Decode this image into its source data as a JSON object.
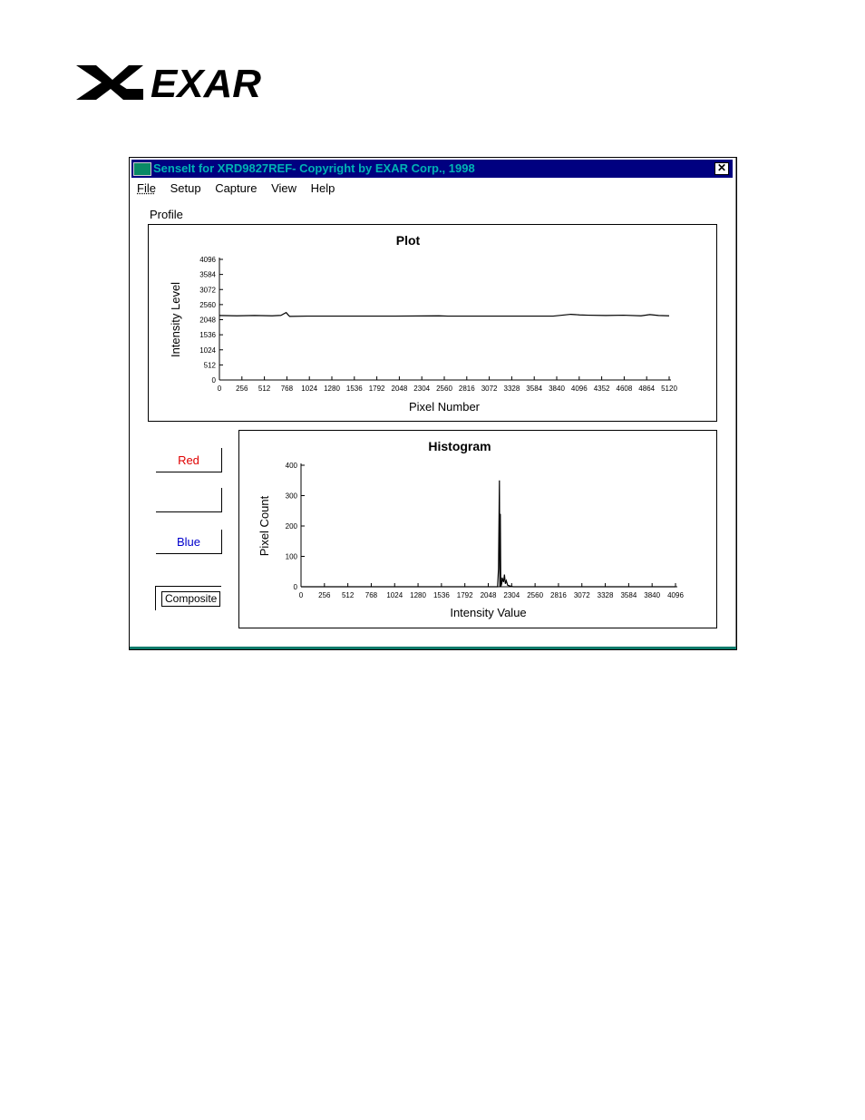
{
  "logo": {
    "text": "EXAR"
  },
  "window": {
    "title": "SenseIt for XRD9827REF- Copyright by EXAR Corp., 1998",
    "close_glyph": "✕"
  },
  "menu": [
    {
      "label": "File"
    },
    {
      "label": "Setup"
    },
    {
      "label": "Capture"
    },
    {
      "label": "View"
    },
    {
      "label": "Help"
    }
  ],
  "profile_label": "Profile",
  "buttons": {
    "red": "Red",
    "green": "",
    "blue": "Blue",
    "composite": "Composite"
  },
  "colors": {
    "titlebar": "#000080",
    "title_text": "#00b3b3",
    "red_button": "#e00000",
    "blue_button": "#0000cc"
  },
  "chart_data": [
    {
      "type": "line",
      "title": "Plot",
      "xlabel": "Pixel Number",
      "ylabel": "Intensity Level",
      "xlim": [
        0,
        5120
      ],
      "ylim": [
        0,
        4096
      ],
      "x_ticks": [
        "0",
        "256",
        "512",
        "768",
        "1024",
        "1280",
        "1536",
        "1792",
        "2048",
        "2304",
        "2560",
        "2816",
        "3072",
        "3328",
        "3584",
        "3840",
        "4096",
        "4352",
        "4608",
        "4864",
        "5120"
      ],
      "y_ticks": [
        "0",
        "512",
        "1024",
        "1536",
        "2048",
        "2560",
        "3072",
        "3584",
        "4096"
      ],
      "series": [
        {
          "x": [
            0,
            200,
            400,
            600,
            700,
            760,
            780,
            800,
            1000,
            1500,
            2000,
            2500,
            2600,
            3000,
            3500,
            3800,
            3900,
            4000,
            4100,
            4200,
            4400,
            4600,
            4800,
            4900,
            5000,
            5120
          ],
          "y": [
            2190,
            2180,
            2190,
            2180,
            2195,
            2290,
            2220,
            2160,
            2170,
            2170,
            2170,
            2180,
            2170,
            2170,
            2170,
            2170,
            2200,
            2230,
            2210,
            2200,
            2190,
            2200,
            2180,
            2220,
            2190,
            2180
          ]
        }
      ]
    },
    {
      "type": "line",
      "title": "Histogram",
      "xlabel": "Intensity Value",
      "ylabel": "Pixel Count",
      "xlim": [
        0,
        4096
      ],
      "ylim": [
        0,
        400
      ],
      "x_ticks": [
        "0",
        "256",
        "512",
        "768",
        "1024",
        "1280",
        "1536",
        "1792",
        "2048",
        "2304",
        "2560",
        "2816",
        "3072",
        "3328",
        "3584",
        "3840",
        "4096"
      ],
      "y_ticks": [
        "0",
        "100",
        "200",
        "300",
        "400"
      ],
      "series": [
        {
          "x": [
            0,
            2150,
            2160,
            2170,
            2175,
            2180,
            2185,
            2195,
            2200,
            2215,
            2225,
            2235,
            2245,
            2260,
            2280,
            2320,
            4096
          ],
          "y": [
            0,
            0,
            60,
            350,
            0,
            240,
            0,
            10,
            30,
            15,
            40,
            10,
            20,
            5,
            3,
            0,
            0
          ]
        }
      ]
    }
  ]
}
